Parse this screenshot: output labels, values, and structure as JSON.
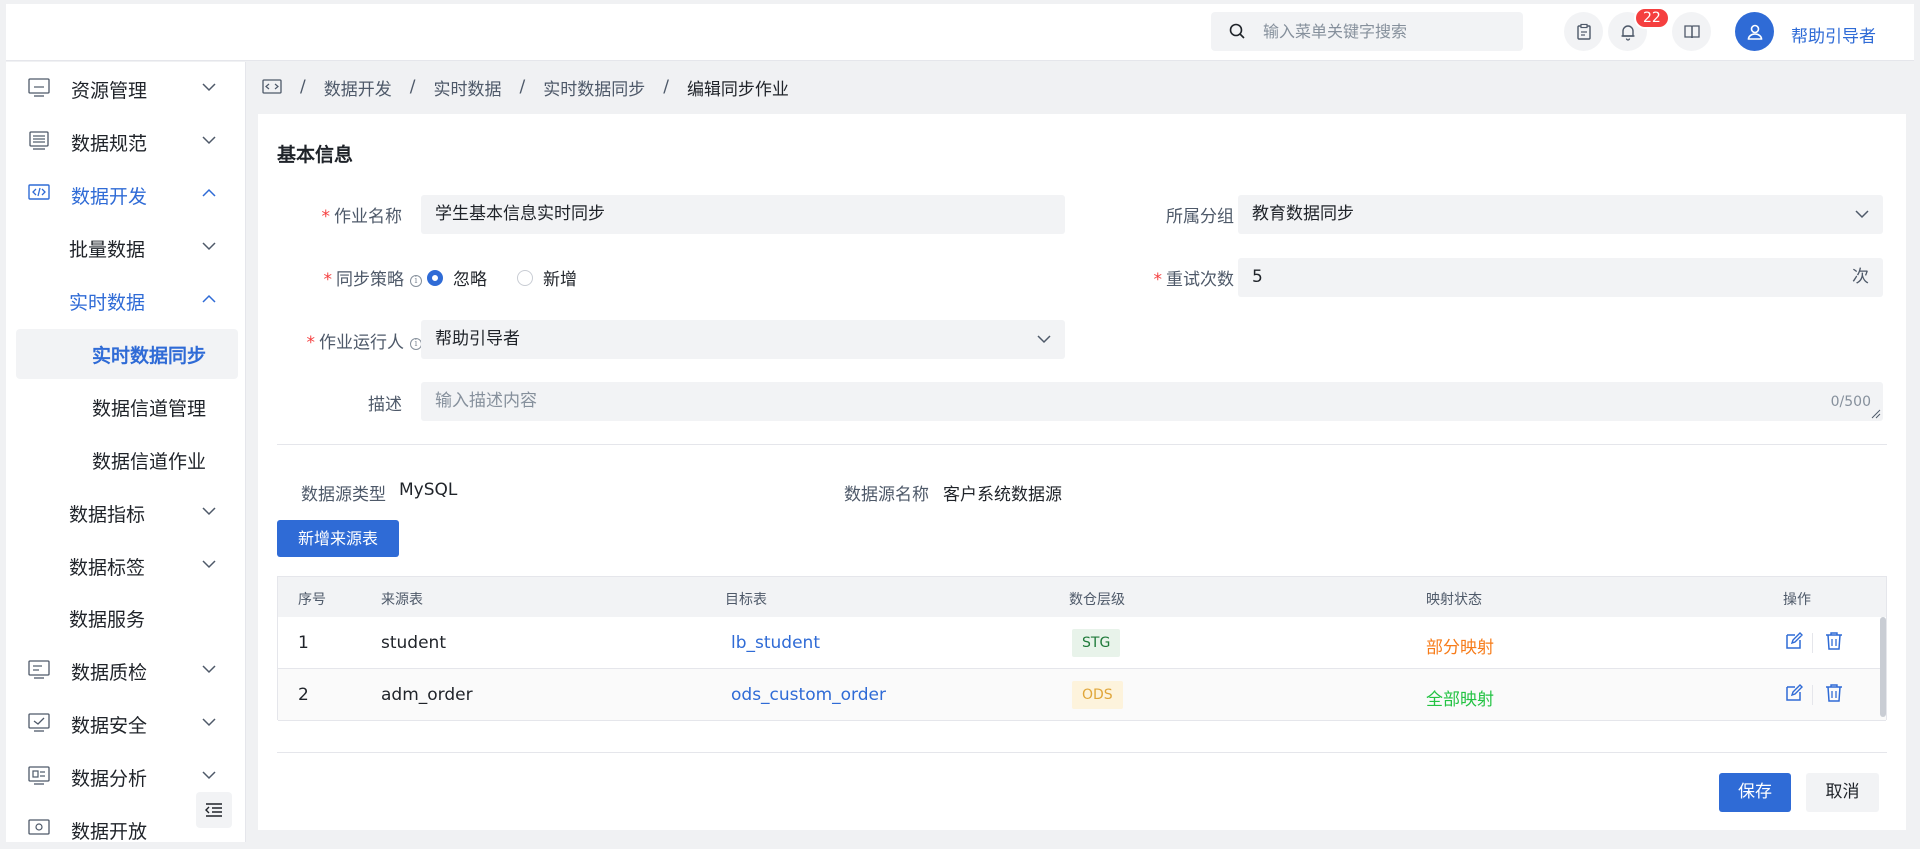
{
  "header": {
    "search_placeholder": "输入菜单关键字搜索",
    "notification_count": "22",
    "username": "帮助引导者"
  },
  "sidebar": {
    "items": [
      {
        "label": "资源管理",
        "icon": "monitor-icon"
      },
      {
        "label": "数据规范",
        "icon": "database-icon"
      },
      {
        "label": "数据开发",
        "icon": "code-icon"
      },
      {
        "label": "批量数据"
      },
      {
        "label": "实时数据"
      },
      {
        "label": "实时数据同步"
      },
      {
        "label": "数据信道管理"
      },
      {
        "label": "数据信道作业"
      },
      {
        "label": "数据指标"
      },
      {
        "label": "数据标签"
      },
      {
        "label": "数据服务"
      },
      {
        "label": "数据质检",
        "icon": "inspection-icon"
      },
      {
        "label": "数据安全",
        "icon": "shield-check-icon"
      },
      {
        "label": "数据分析",
        "icon": "analysis-icon"
      },
      {
        "label": "数据开放",
        "icon": "open-icon"
      }
    ]
  },
  "breadcrumb": {
    "items": [
      "数据开发",
      "实时数据",
      "实时数据同步"
    ],
    "current": "编辑同步作业",
    "separator": "/"
  },
  "form": {
    "section_title": "基本信息",
    "job_name_label": "作业名称",
    "job_name_value": "学生基本信息实时同步",
    "group_label": "所属分组",
    "group_value": "教育数据同步",
    "sync_strategy_label": "同步策略",
    "strategy_options": [
      "忽略",
      "新增"
    ],
    "strategy_selected": "忽略",
    "retry_label": "重试次数",
    "retry_value": "5",
    "retry_unit": "次",
    "runner_label": "作业运行人",
    "runner_value": "帮助引导者",
    "desc_label": "描述",
    "desc_placeholder": "输入描述内容",
    "desc_count": "0/500",
    "required_mark": "*"
  },
  "datasource": {
    "type_label": "数据源类型",
    "type_value": "MySQL",
    "name_label": "数据源名称",
    "name_value": "客户系统数据源",
    "add_button": "新增来源表"
  },
  "table": {
    "columns": [
      "序号",
      "来源表",
      "目标表",
      "数仓层级",
      "映射状态",
      "操作"
    ],
    "rows": [
      {
        "index": "1",
        "source": "student",
        "target": "lb_student",
        "layer": "STG",
        "status": "部分映射"
      },
      {
        "index": "2",
        "source": "adm_order",
        "target": "ods_custom_order",
        "layer": "ODS",
        "status": "全部映射"
      }
    ]
  },
  "actions": {
    "save": "保存",
    "cancel": "取消"
  },
  "colors": {
    "accent": "#2f6bd6",
    "danger": "#f53f3f",
    "warning": "#f77c1a",
    "success": "#23c343"
  }
}
